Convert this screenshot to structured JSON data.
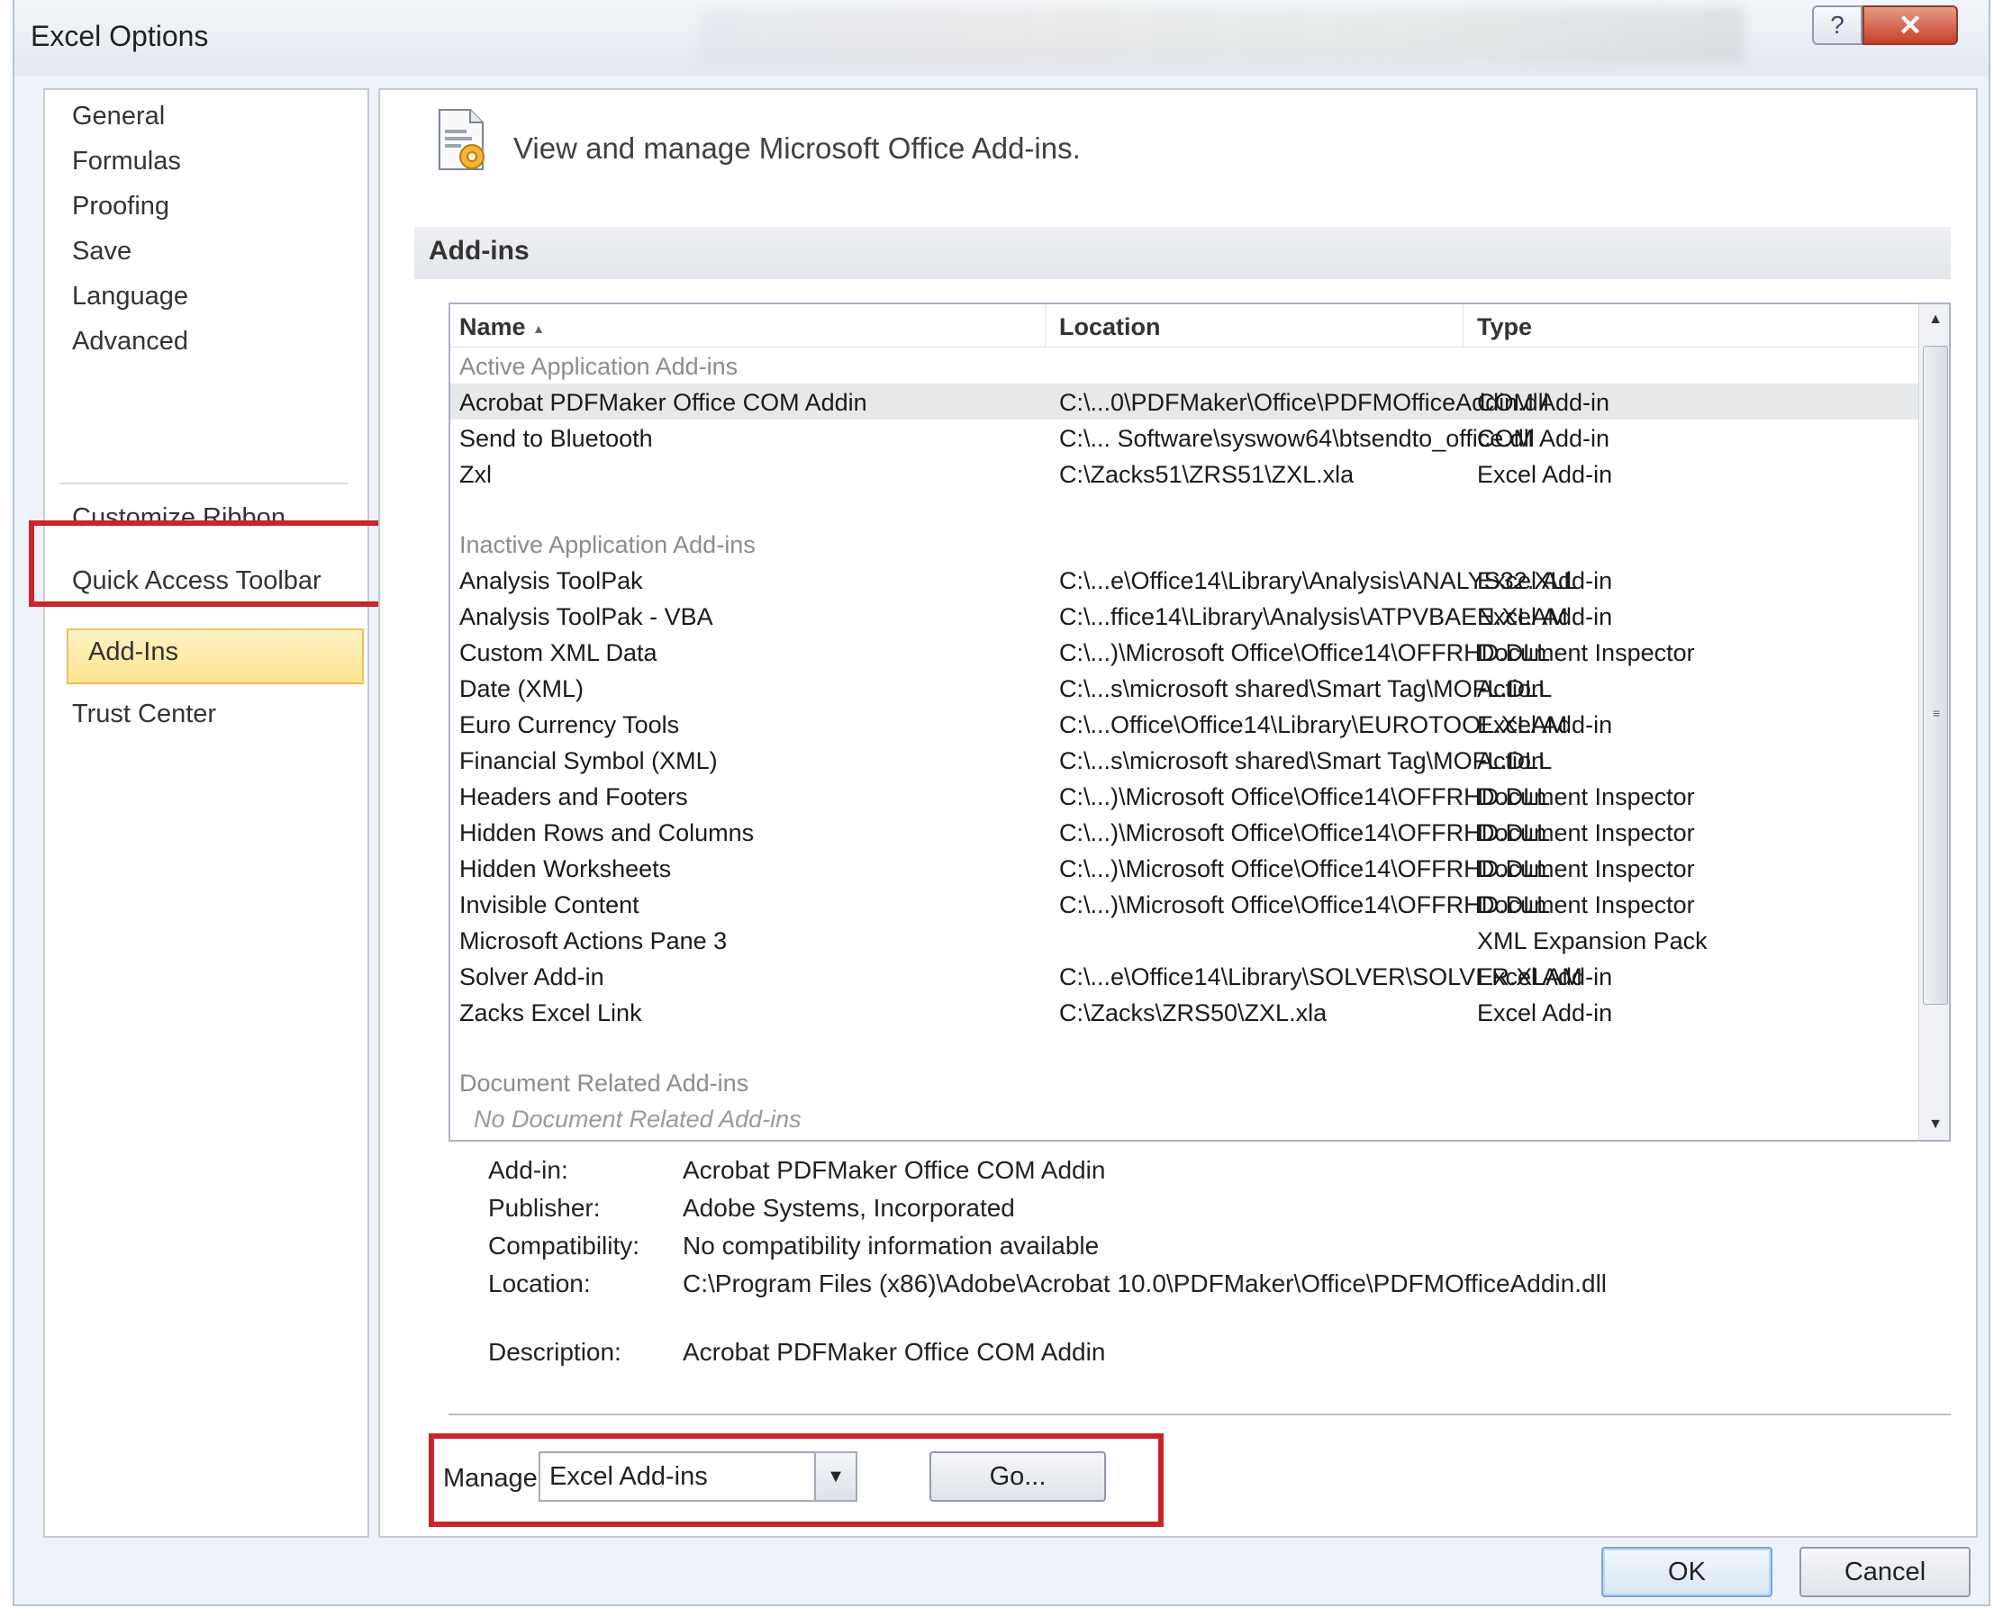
{
  "window": {
    "title": "Excel Options",
    "help_label": "?",
    "close_label": "✕"
  },
  "nav": {
    "items": [
      {
        "label": "General"
      },
      {
        "label": "Formulas"
      },
      {
        "label": "Proofing"
      },
      {
        "label": "Save"
      },
      {
        "label": "Language"
      },
      {
        "label": "Advanced"
      },
      {
        "label": "Customize Ribbon"
      },
      {
        "label": "Quick Access Toolbar"
      },
      {
        "label": "Add-Ins"
      },
      {
        "label": "Trust Center"
      }
    ],
    "selected": "Add-Ins"
  },
  "content": {
    "header_text": "View and manage Microsoft Office Add-ins.",
    "section_title": "Add-ins",
    "columns": {
      "name": "Name",
      "sort_indicator": "▲",
      "location": "Location",
      "type": "Type"
    },
    "groups": [
      {
        "title": "Active Application Add-ins",
        "rows": [
          {
            "name": "Acrobat PDFMaker Office COM Addin",
            "location": "C:\\...0\\PDFMaker\\Office\\PDFMOfficeAddin.dll",
            "type": "COM Add-in"
          },
          {
            "name": "Send to Bluetooth",
            "location": "C:\\... Software\\syswow64\\btsendto_office.dll",
            "type": "COM Add-in"
          },
          {
            "name": "Zxl",
            "location": "C:\\Zacks51\\ZRS51\\ZXL.xla",
            "type": "Excel Add-in"
          }
        ]
      },
      {
        "title": "Inactive Application Add-ins",
        "rows": [
          {
            "name": "Analysis ToolPak",
            "location": "C:\\...e\\Office14\\Library\\Analysis\\ANALYS32.XLL",
            "type": "Excel Add-in"
          },
          {
            "name": "Analysis ToolPak - VBA",
            "location": "C:\\...ffice14\\Library\\Analysis\\ATPVBAEN.XLAM",
            "type": "Excel Add-in"
          },
          {
            "name": "Custom XML Data",
            "location": "C:\\...)\\Microsoft Office\\Office14\\OFFRHD.DLL",
            "type": "Document Inspector"
          },
          {
            "name": "Date (XML)",
            "location": "C:\\...s\\microsoft shared\\Smart Tag\\MOFL.DLL",
            "type": "Action"
          },
          {
            "name": "Euro Currency Tools",
            "location": "C:\\...Office\\Office14\\Library\\EUROTOOL.XLAM",
            "type": "Excel Add-in"
          },
          {
            "name": "Financial Symbol (XML)",
            "location": "C:\\...s\\microsoft shared\\Smart Tag\\MOFL.DLL",
            "type": "Action"
          },
          {
            "name": "Headers and Footers",
            "location": "C:\\...)\\Microsoft Office\\Office14\\OFFRHD.DLL",
            "type": "Document Inspector"
          },
          {
            "name": "Hidden Rows and Columns",
            "location": "C:\\...)\\Microsoft Office\\Office14\\OFFRHD.DLL",
            "type": "Document Inspector"
          },
          {
            "name": "Hidden Worksheets",
            "location": "C:\\...)\\Microsoft Office\\Office14\\OFFRHD.DLL",
            "type": "Document Inspector"
          },
          {
            "name": "Invisible Content",
            "location": "C:\\...)\\Microsoft Office\\Office14\\OFFRHD.DLL",
            "type": "Document Inspector"
          },
          {
            "name": "Microsoft Actions Pane 3",
            "location": "",
            "type": "XML Expansion Pack"
          },
          {
            "name": "Solver Add-in",
            "location": "C:\\...e\\Office14\\Library\\SOLVER\\SOLVER.XLAM",
            "type": "Excel Add-in"
          },
          {
            "name": "Zacks Excel Link",
            "location": "C:\\Zacks\\ZRS50\\ZXL.xla",
            "type": "Excel Add-in"
          }
        ]
      },
      {
        "title": "Document Related Add-ins",
        "empty_text": "No Document Related Add-ins",
        "rows": []
      }
    ],
    "selected_row": "Acrobat PDFMaker Office COM Addin",
    "details": {
      "addin_label": "Add-in:",
      "addin_value": "Acrobat PDFMaker Office COM Addin",
      "publisher_label": "Publisher:",
      "publisher_value": "Adobe Systems, Incorporated",
      "compat_label": "Compatibility:",
      "compat_value": "No compatibility information available",
      "location_label": "Location:",
      "location_value": "C:\\Program Files (x86)\\Adobe\\Acrobat 10.0\\PDFMaker\\Office\\PDFMOfficeAddin.dll",
      "description_label": "Description:",
      "description_value": "Acrobat PDFMaker Office COM Addin"
    },
    "manage": {
      "label": "Manage:",
      "selected": "Excel Add-ins",
      "go_label": "Go..."
    }
  },
  "footer": {
    "ok_label": "OK",
    "cancel_label": "Cancel"
  },
  "colors": {
    "highlight_red": "#c8252c",
    "nav_selected_bg": "#fde390",
    "window_bg": "#eef3f9"
  }
}
